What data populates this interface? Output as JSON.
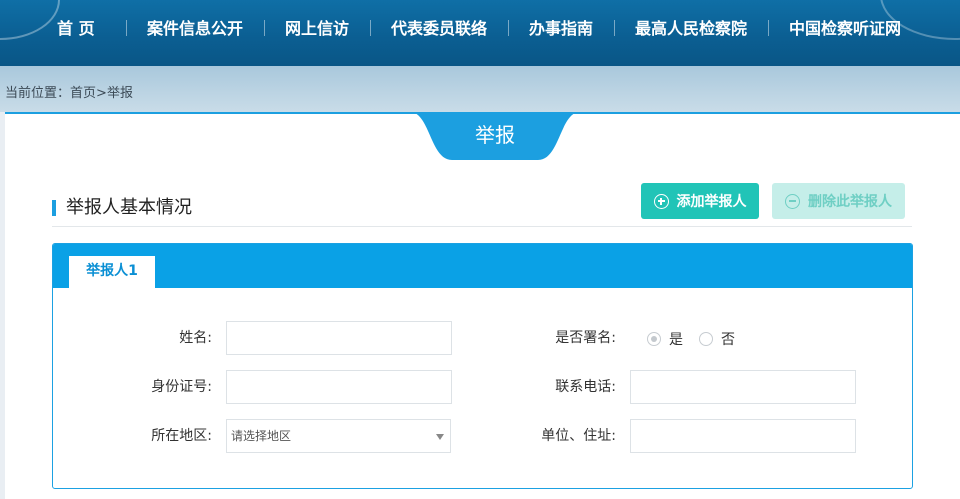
{
  "nav": {
    "items": [
      {
        "label": "首 页"
      },
      {
        "label": "案件信息公开"
      },
      {
        "label": "网上信访"
      },
      {
        "label": "代表委员联络"
      },
      {
        "label": "办事指南"
      },
      {
        "label": "最高人民检察院"
      },
      {
        "label": "中国检察听证网"
      }
    ]
  },
  "breadcrumb": {
    "prefix": "当前位置：",
    "home": "首页",
    "separator": ">",
    "current": "举报"
  },
  "page": {
    "title": "举报"
  },
  "section": {
    "title": "举报人基本情况",
    "add_button": "添加举报人",
    "delete_button": "删除此举报人"
  },
  "form": {
    "tab_label": "举报人1",
    "name_label": "姓名:",
    "signed_label": "是否署名:",
    "signed_yes": "是",
    "signed_no": "否",
    "id_label": "身份证号:",
    "phone_label": "联系电话:",
    "region_label": "所在地区:",
    "region_placeholder": "请选择地区",
    "address_label": "单位、住址:",
    "name_value": "",
    "id_value": "",
    "phone_value": "",
    "address_value": ""
  },
  "colors": {
    "nav_bg": "#0b5f93",
    "accent": "#1c9fe0",
    "teal": "#21c4b7",
    "teal_light": "#c5eee9"
  }
}
